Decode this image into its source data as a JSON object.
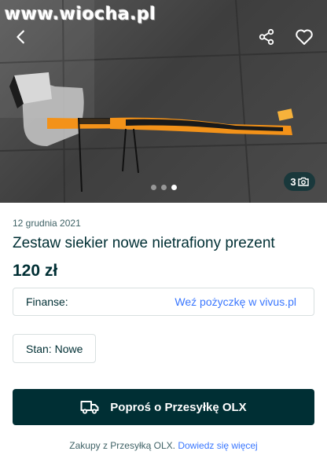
{
  "watermark": "www.wiocha.pl",
  "gallery": {
    "photo_count": "3",
    "icons": {
      "back": "back-arrow-icon",
      "share": "share-icon",
      "favorite": "heart-icon",
      "camera": "camera-icon"
    },
    "dots": 3,
    "active_dot": 2
  },
  "listing": {
    "date": "12 grudnia 2021",
    "title": "Zestaw siekier nowe nietrafiony prezent",
    "price": "120 zł"
  },
  "finance": {
    "label": "Finanse:",
    "link": "Weź pożyczkę w vivus.pl"
  },
  "condition": "Stan: Nowe",
  "cta": {
    "label": "Poproś o Przesyłkę OLX",
    "icon": "delivery-truck-icon"
  },
  "footer_info": {
    "text": "Zakupy z Przesyłką OLX.",
    "link": "Dowiedz się więcej"
  },
  "colors": {
    "primary": "#002f34",
    "link": "#3a77ff",
    "axe_handle": "#f39219"
  }
}
